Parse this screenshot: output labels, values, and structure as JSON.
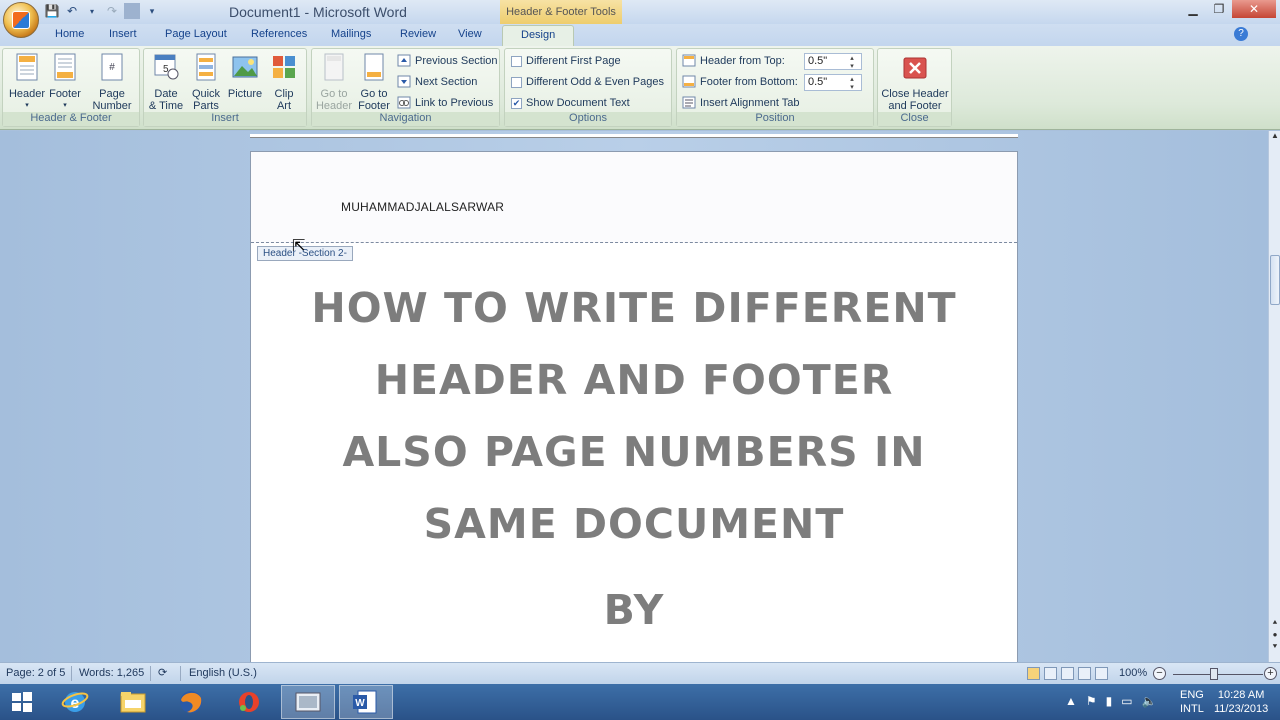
{
  "titlebar": {
    "title": "Document1 - Microsoft Word",
    "contextual_tab": "Header & Footer Tools"
  },
  "tabs": [
    "Home",
    "Insert",
    "Page Layout",
    "References",
    "Mailings",
    "Review",
    "View",
    "Design"
  ],
  "active_tab": "Design",
  "ribbon": {
    "header_footer": {
      "label": "Header & Footer",
      "header": "Header",
      "footer": "Footer",
      "page_number_1": "Page",
      "page_number_2": "Number"
    },
    "insert": {
      "label": "Insert",
      "date_time_1": "Date",
      "date_time_2": "& Time",
      "quick_parts_1": "Quick",
      "quick_parts_2": "Parts",
      "picture": "Picture",
      "clip_art_1": "Clip",
      "clip_art_2": "Art"
    },
    "navigation": {
      "label": "Navigation",
      "goto_header_1": "Go to",
      "goto_header_2": "Header",
      "goto_footer_1": "Go to",
      "goto_footer_2": "Footer",
      "previous_section": "Previous Section",
      "next_section": "Next Section",
      "link_to_previous": "Link to Previous"
    },
    "options": {
      "label": "Options",
      "different_first_page": "Different First Page",
      "different_odd_even": "Different Odd & Even Pages",
      "show_document_text": "Show Document Text",
      "show_document_text_checked": true
    },
    "position": {
      "label": "Position",
      "header_from_top": "Header from Top:",
      "header_from_top_value": "0.5\"",
      "footer_from_bottom": "Footer from Bottom:",
      "footer_from_bottom_value": "0.5\"",
      "insert_alignment_tab": "Insert Alignment Tab"
    },
    "close": {
      "label": "Close",
      "close_1": "Close Header",
      "close_2": "and Footer"
    }
  },
  "document": {
    "header_text": "MUHAMMADJALALSARWAR",
    "header_tag": "Header -Section 2-",
    "lines": [
      "HOW TO WRITE DIFFERENT",
      "HEADER AND FOOTER",
      "ALSO PAGE NUMBERS IN",
      "SAME DOCUMENT",
      "BY"
    ]
  },
  "statusbar": {
    "page": "Page: 2 of 5",
    "words": "Words: 1,265",
    "language": "English (U.S.)",
    "zoom": "100%"
  },
  "taskbar": {
    "lang_1": "ENG",
    "lang_2": "INTL",
    "time": "10:28 AM",
    "date": "11/23/2013"
  },
  "colors": {
    "accent": "#15428b",
    "contextual_tab": "#eecd6d",
    "taskbar": "#2a5288",
    "close_button": "#d9534f"
  }
}
